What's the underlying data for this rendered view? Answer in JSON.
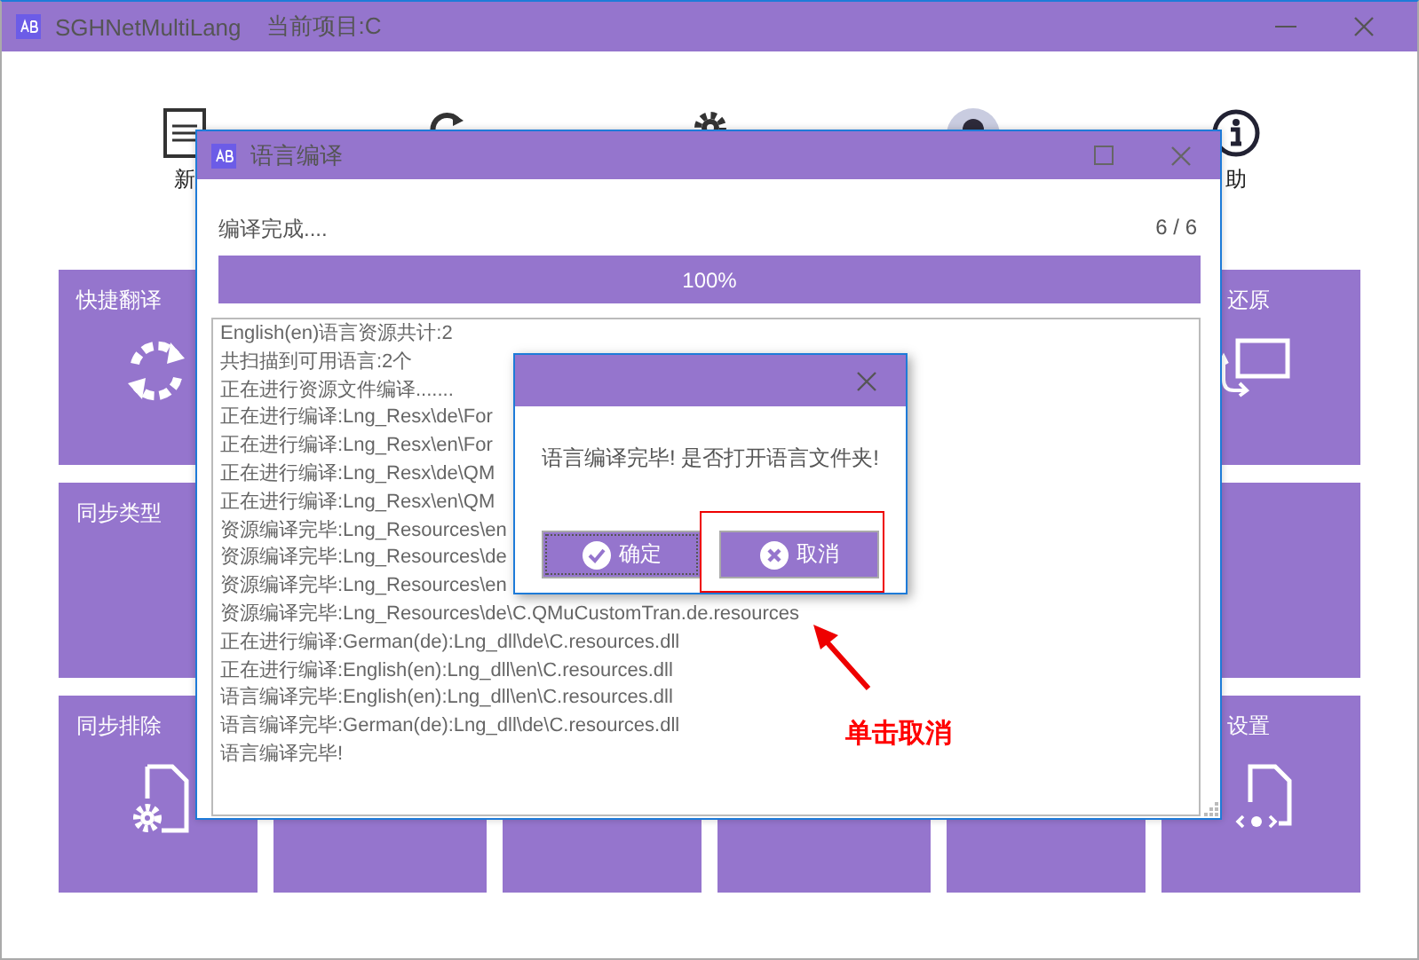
{
  "window": {
    "title": "SGHNetMultiLang",
    "project": "当前项目:C"
  },
  "toolbar_labels": [
    "新",
    "助"
  ],
  "left_tiles": [
    "快捷翻译",
    "同步类型",
    "同步排除"
  ],
  "right_tiles": {
    "top": "还原",
    "bottom": "设置"
  },
  "compile_dialog": {
    "title": "语言编译",
    "status": "编译完成....",
    "count": "6 / 6",
    "progress": {
      "level": 1,
      "text": "100%"
    },
    "log": [
      "English(en)语言资源共计:2",
      "共扫描到可用语言:2个",
      "正在进行资源文件编译.......",
      "正在进行编译:Lng_Resx\\de\\For",
      "正在进行编译:Lng_Resx\\en\\For",
      "正在进行编译:Lng_Resx\\de\\QM",
      "正在进行编译:Lng_Resx\\en\\QM",
      "资源编译完毕:Lng_Resources\\en",
      "资源编译完毕:Lng_Resources\\de",
      "资源编译完毕:Lng_Resources\\en",
      "资源编译完毕:Lng_Resources\\de\\C.QMuCustomTran.de.resources",
      "正在进行编译:German(de):Lng_dll\\de\\C.resources.dll",
      "正在进行编译:English(en):Lng_dll\\en\\C.resources.dll",
      "语言编译完毕:English(en):Lng_dll\\en\\C.resources.dll",
      "语言编译完毕:German(de):Lng_dll\\de\\C.resources.dll",
      "语言编译完毕!"
    ]
  },
  "message_box": {
    "message": "语言编译完毕! 是否打开语言文件夹!",
    "buttons": [
      {
        "label": "确定",
        "kind": "ok",
        "focused": true
      },
      {
        "label": "取消",
        "kind": "cancel",
        "focused": false
      }
    ]
  },
  "annotation": {
    "text": "单击取消"
  }
}
